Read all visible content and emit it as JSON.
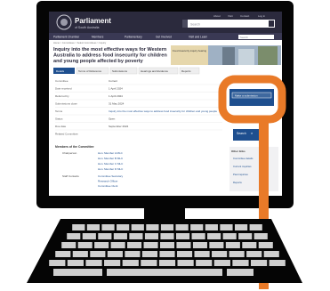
{
  "site": {
    "name": "Parliament",
    "sub": "of South Australia",
    "search_placeholder": "Search",
    "top_links": [
      "About",
      "Visit",
      "Contact",
      "Log in"
    ]
  },
  "nav": [
    "Parliament Chamber",
    "Members",
    "Parliamentary",
    "Get Involved",
    "Visit and Learn"
  ],
  "breadcrumb": "Home > Committees > Select Committees > Inquiry",
  "page": {
    "title": "Inquiry into the most effective ways for Western Australia to address food insecurity for children and young people affected by poverty",
    "hero_caption": "Food insecurity inquiry hearing"
  },
  "tabs": [
    "Details",
    "Terms of Reference",
    "Submissions",
    "Hearings and Evidence",
    "Reports"
  ],
  "details": [
    {
      "label": "Committee",
      "value": "Current"
    },
    {
      "label": "Date received",
      "value": "1 April 2024"
    },
    {
      "label": "Referred by",
      "value": "1 April 2024"
    },
    {
      "label": "Submissions close",
      "value": "31 May 2024"
    },
    {
      "label": "Terms",
      "value": "Inquiry into the most effective ways to address food insecurity for children and young people"
    },
    {
      "label": "Status",
      "value": "Open"
    },
    {
      "label": "Due date",
      "value": "September 2024"
    },
    {
      "label": "Related Committee",
      "value": ""
    }
  ],
  "members_heading": "Members of the Committee",
  "members": [
    {
      "role": "Chairperson",
      "name": "Hon. Member A MLC"
    },
    {
      "role": "",
      "name": "Hon. Member B MLC"
    },
    {
      "role": "",
      "name": "Hon. Member C MLC"
    },
    {
      "role": "",
      "name": "Hon. Member D MLC"
    }
  ],
  "staff": [
    {
      "role": "Staff Contacts",
      "name": "Committee Secretary"
    },
    {
      "role": "",
      "name": "Research Officer"
    },
    {
      "role": "",
      "name": "Committee Clerk"
    }
  ],
  "sidebar": {
    "button_label": "Make a submission",
    "search_label": "Search",
    "links_heading": "Other links",
    "links": [
      "Committee details",
      "Current inquiries",
      "Past inquiries",
      "Reports"
    ]
  },
  "pointer_color": "#e97a28"
}
